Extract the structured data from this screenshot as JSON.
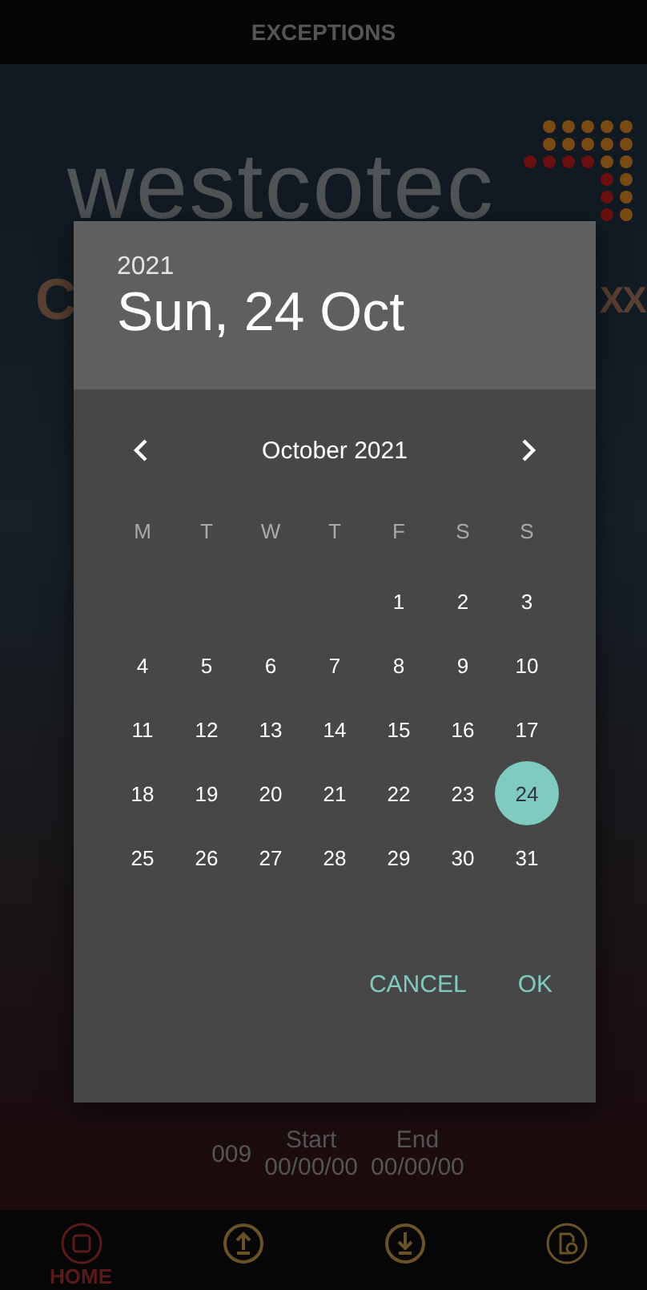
{
  "top_bar": {
    "title": "EXCEPTIONS"
  },
  "background": {
    "logo": "westcotec",
    "title_left": "C",
    "title_right": "XX"
  },
  "date_dialog": {
    "year": "2021",
    "date": "Sun, 24 Oct",
    "month": "October 2021",
    "weekdays": [
      "M",
      "T",
      "W",
      "T",
      "F",
      "S",
      "S"
    ],
    "weeks": [
      {
        "kind": "partial",
        "days": [
          {
            "label": "1",
            "selected": false
          },
          {
            "label": "2",
            "selected": false
          },
          {
            "label": "3",
            "selected": false
          }
        ]
      },
      {
        "kind": "full",
        "days": [
          {
            "label": "4",
            "selected": false
          },
          {
            "label": "5",
            "selected": false
          },
          {
            "label": "6",
            "selected": false
          },
          {
            "label": "7",
            "selected": false
          },
          {
            "label": "8",
            "selected": false
          },
          {
            "label": "9",
            "selected": false
          },
          {
            "label": "10",
            "selected": false
          }
        ]
      },
      {
        "kind": "full",
        "days": [
          {
            "label": "11",
            "selected": false
          },
          {
            "label": "12",
            "selected": false
          },
          {
            "label": "13",
            "selected": false
          },
          {
            "label": "14",
            "selected": false
          },
          {
            "label": "15",
            "selected": false
          },
          {
            "label": "16",
            "selected": false
          },
          {
            "label": "17",
            "selected": false
          }
        ]
      },
      {
        "kind": "full",
        "days": [
          {
            "label": "18",
            "selected": false
          },
          {
            "label": "19",
            "selected": false
          },
          {
            "label": "20",
            "selected": false
          },
          {
            "label": "21",
            "selected": false
          },
          {
            "label": "22",
            "selected": false
          },
          {
            "label": "23",
            "selected": false
          },
          {
            "label": "24",
            "selected": true
          }
        ]
      },
      {
        "kind": "full",
        "days": [
          {
            "label": "25",
            "selected": false
          },
          {
            "label": "26",
            "selected": false
          },
          {
            "label": "27",
            "selected": false
          },
          {
            "label": "28",
            "selected": false
          },
          {
            "label": "29",
            "selected": false
          },
          {
            "label": "30",
            "selected": false
          },
          {
            "label": "31",
            "selected": false
          }
        ]
      }
    ],
    "buttons": [
      "CANCEL",
      "OK"
    ]
  },
  "info": {
    "number": "009",
    "start_label": "Start",
    "start_value": "00/00/00",
    "end_label": "End",
    "end_value": "00/00/00"
  },
  "nav": [
    {
      "kind": "home",
      "label": "HOME",
      "selected": true
    },
    {
      "kind": "upload",
      "selected": false
    },
    {
      "kind": "download",
      "selected": false
    },
    {
      "kind": "file-clock",
      "selected": false
    }
  ]
}
